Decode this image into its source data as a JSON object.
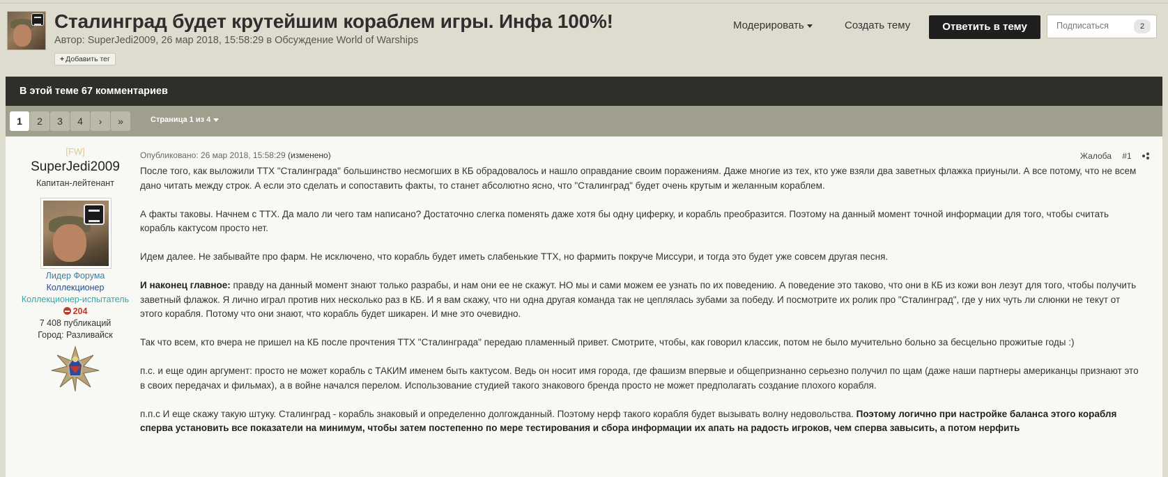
{
  "topic": {
    "title": "Сталинград будет крутейшим кораблем игры. Инфа 100%!",
    "meta": "Автор: SuperJedi2009, 26 мар 2018, 15:58:29 в Обсуждение World of Warships",
    "add_tag_label": "Добавить тег"
  },
  "toolbar": {
    "moderate_label": "Модерировать",
    "create_topic_label": "Создать тему",
    "reply_label": "Ответить в тему",
    "follow_label": "Подписаться",
    "follow_count": "2"
  },
  "comments_bar": {
    "text": "В этой теме 67 комментариев"
  },
  "pagination": {
    "pages": [
      "1",
      "2",
      "3",
      "4"
    ],
    "active_page": "1",
    "next_label": "›",
    "last_label": "»",
    "page_select_label": "Страница 1 из 4"
  },
  "author": {
    "clan": "[FW]",
    "username": "SuperJedi2009",
    "rank": "Капитан-лейтенант",
    "group_1": "Лидер Форума",
    "group_2": "Коллекционер",
    "group_3": "Коллекционер-испытатель",
    "reputation": "204",
    "posts_count": "7 408 публикаций",
    "city": "Город: Разливайск"
  },
  "post": {
    "published": "Опубликовано: 26 мар 2018, 15:58:29",
    "edited": "(изменено)",
    "report_label": "Жалоба",
    "number": "#1",
    "p1": "После того, как выложили ТТХ \"Сталинграда\" большинство несмогших в КБ обрадовалось и нашло оправдание своим поражениям. Даже многие из тех, кто уже взяли два заветных флажка приуныли. А все потому, что не всем дано читать между строк. А если это сделать и сопоставить факты, то станет абсолютно  ясно, что \"Сталинград\" будет очень крутым и желанным кораблем.",
    "p2": "А факты таковы. Начнем с ТТХ. Да мало ли чего там написано? Достаточно слегка поменять даже хотя бы одну циферку, и корабль преобразится. Поэтому на данный момент точной информации для того, чтобы считать корабль кактусом просто нет.",
    "p3": "Идем далее. Не забывайте про фарм. Не исключено, что корабль будет иметь слабенькие ТТХ, но фармить покруче Миссури, и тогда это будет уже совсем другая песня.",
    "p4_bold": "И наконец главное:",
    "p4": " правду на данный момент знают только разрабы, и нам они ее не скажут. НО мы и сами можем ее узнать по их поведению. А поведение  это таково, что они в КБ из кожи вон лезут для того, чтобы получить заветный флажок. Я лично играл против них несколько раз в КБ. И я вам скажу, что ни одна другая команда так не цеплялась зубами за победу. И посмотрите их ролик про \"Сталинград\", где у них чуть ли слюнки не текут от этого корабля. Потому что они знают, что корабль будет шикарен. И мне это очевидно.",
    "p5": "Так что всем, кто вчера  не пришел на КБ после прочтения ТТХ \"Сталинграда\" передаю пламенный привет. Смотрите, чтобы, как говорил классик,  потом не было мучительно больно за бесцельно прожитые годы :)",
    "p6": "п.с. и еще один аргумент: просто не может корабль с ТАКИМ именем быть кактусом. Ведь он носит имя города, где фашизм впервые и общепризнанно серьезно получил по щам (даже наши партнеры американцы признают это в своих передачах и фильмах),  а в войне начался перелом.   Использование студией такого знакового  бренда просто не может предполагать создание плохого корабля.",
    "p7": "п.п.с И еще скажу такую штуку. Сталинград - корабль знаковый и определенно долгожданный. Поэтому  нерф такого корабля будет вызывать волну недовольства. ",
    "p7_bold": "Поэтому логично при настройке баланса этого корабля  сперва установить все показатели на минимум, чтобы затем постепенно по мере тестирования и сбора информации их апать на радость игроков, чем сперва завысить, а потом нерфить"
  }
}
